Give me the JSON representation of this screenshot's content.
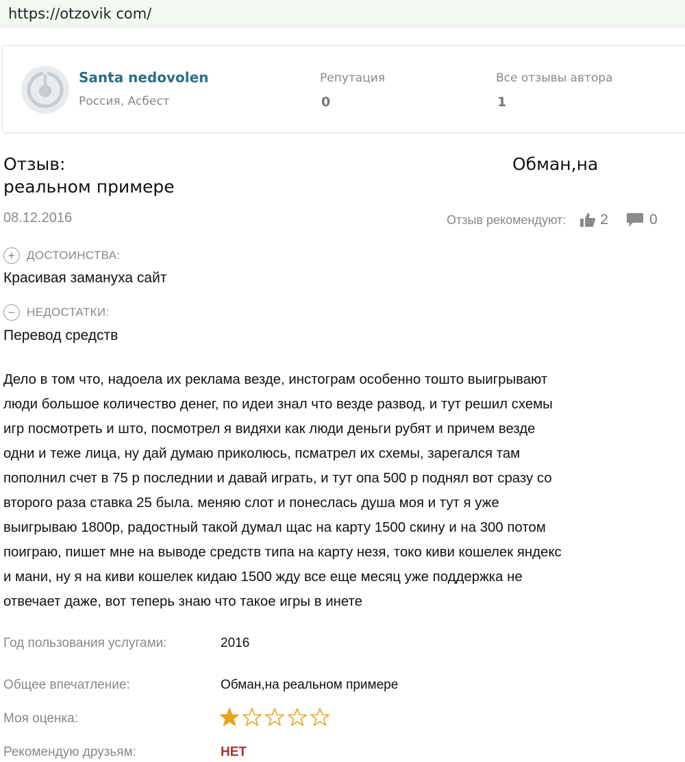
{
  "url": "https://otzovik com/",
  "author": {
    "name": "Santa nedovolen",
    "location": "Россия, Асбест",
    "reputation_label": "Репутация",
    "reputation_value": "0",
    "reviews_label": "Все отзывы автора",
    "reviews_value": "1"
  },
  "review": {
    "title_prefix": "Отзыв:",
    "title_part1": "Обман,на",
    "title_part2": "реальном примере",
    "date": "08.12.2016",
    "recommend_label": "Отзыв рекомендуют:",
    "likes": "2",
    "comments": "0",
    "pros_label": "ДОСТОИНСТВА:",
    "pros_text": "Красивая замануха сайт",
    "cons_label": "НЕДОСТАТКИ:",
    "cons_text": "Перевод средств",
    "body_lines": [
      "Дело в том что, надоела их реклама везде, инстограм особенно тошто выигрывают",
      "люди большое количество денег, по идеи знал что везде развод, и тут решил схемы",
      "игр посмотреть и што, посмотрел я видяхи как люди деньги рубят и причем везде",
      "одни и теже лица, ну дай думаю приколюсь, псматрел их схемы, зарегался там",
      "пополнил счет в 75 р последнии и давай играть, и тут опа 500 р поднял вот сразу со",
      "второго раза ставка 25 была. меняю слот и понеслась душа моя и тут я уже",
      "выигрываю 1800р, радостный такой думал щас на карту 1500 скину и на 300 потом",
      "поиграю, пишет мне на выводе средств типа на карту незя, токо киви кошелек яндекс",
      "и мани, ну я на киви кошелек кидаю 1500 жду все еще месяц уже поддержка не",
      "отвечает даже, вот теперь знаю что такое игры в инете"
    ]
  },
  "meta": {
    "year_label": "Год пользования услугами:",
    "year_value": "2016",
    "impression_label": "Общее впечатление:",
    "impression_value": "Обман,на реальном примере",
    "rating_label": "Моя оценка:",
    "rating": 1,
    "rating_max": 5,
    "recommend_label": "Рекомендую друзьям:",
    "recommend_value": "НЕТ"
  },
  "colors": {
    "author_name": "#2d6e86",
    "muted": "#888888",
    "star_fill": "#e8a21a",
    "no": "#b03030"
  }
}
